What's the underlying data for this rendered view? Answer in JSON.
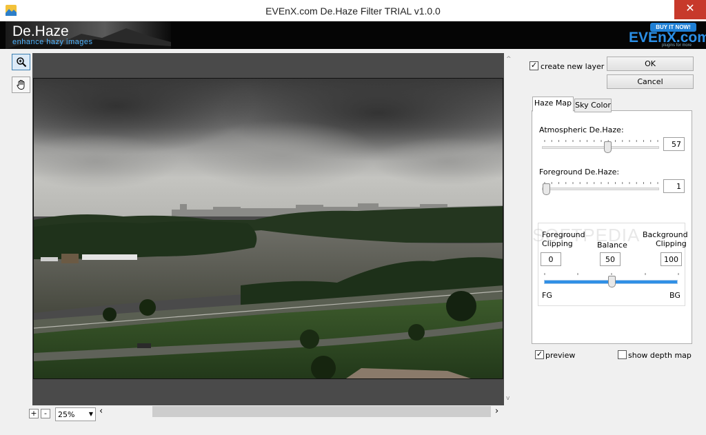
{
  "window": {
    "title": "EVEnX.com De.Haze Filter TRIAL v1.0.0",
    "close_glyph": "✕"
  },
  "banner": {
    "product": "De.Haze",
    "tagline": "enhance hazy images",
    "buy_label": "BUY IT NOW!",
    "brand": "EVEnX.com",
    "brand_sub": "plugins for more"
  },
  "tools": {
    "zoom_tool_icon": "zoom-in-icon",
    "hand_tool_icon": "hand-pan-icon"
  },
  "preview": {
    "zoom_in_label": "+",
    "zoom_out_label": "-",
    "zoom_value": "25%",
    "scroll_left": "‹",
    "scroll_right": "›",
    "scroll_up": "^",
    "scroll_down": "v"
  },
  "options": {
    "create_new_layer": {
      "label": "create new layer",
      "checked": true
    },
    "ok_label": "OK",
    "cancel_label": "Cancel",
    "preview": {
      "label": "preview",
      "checked": true
    },
    "show_depth_map": {
      "label": "show depth map",
      "checked": false
    }
  },
  "tabs": [
    {
      "label": "Haze Map",
      "selected": true
    },
    {
      "label": "Sky Color",
      "selected": false
    }
  ],
  "haze_map": {
    "atmospheric": {
      "label": "Atmospheric De.Haze:",
      "value": "57",
      "level": 0.57
    },
    "foreground": {
      "label": "Foreground De.Haze:",
      "value": "1",
      "level": 0.0
    },
    "clipping": {
      "fg_label_line1": "Foreground",
      "fg_label_line2": "Clipping",
      "balance_label": "Balance",
      "bg_label_line1": "Background",
      "bg_label_line2": "Clipping",
      "fg_value": "0",
      "balance_value": "50",
      "bg_value": "100",
      "balance_level": 0.5,
      "fg_end_label": "FG",
      "bg_end_label": "BG"
    }
  },
  "watermark": "SOFTPEDIA",
  "colors": {
    "accent": "#2f8fe5",
    "close_button": "#c7392b",
    "canvas_bg": "#4a4a4a"
  }
}
